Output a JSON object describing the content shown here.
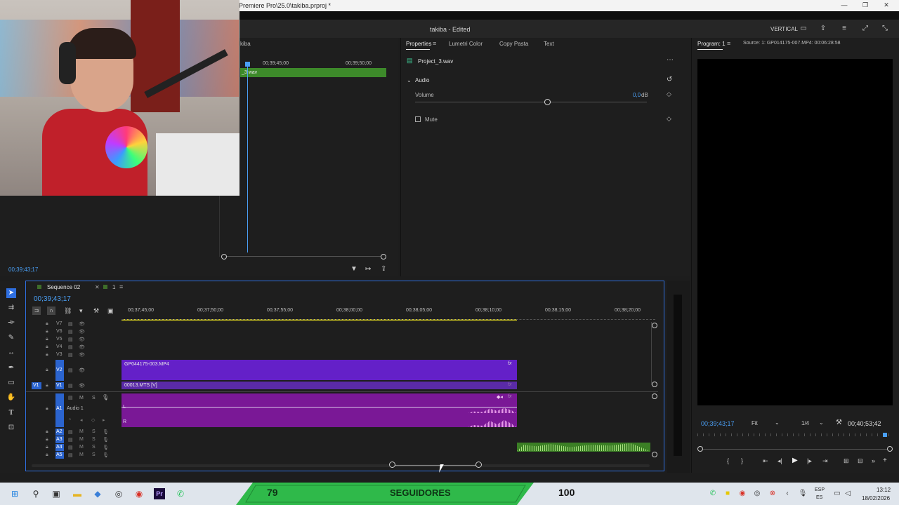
{
  "window": {
    "title": "Premiere Pro\\25.0\\takiba.prproj *",
    "minimize": "—",
    "restore": "❐",
    "close": "✕"
  },
  "header": {
    "project": "takiba - Edited",
    "workspace": "VERTICAL"
  },
  "source_monitor": {
    "tab_fragment": "kiba",
    "ruler": [
      "00;39;45;00",
      "00;39;50;00"
    ],
    "clip_name": "_3.wav",
    "timecode": "00;39;43;17"
  },
  "properties": {
    "tabs": [
      "Properties",
      "Lumetri Color",
      "Copy Pasta",
      "Text"
    ],
    "file_name": "Project_3.wav",
    "section": "Audio",
    "volume_label": "Volume",
    "volume_value": "0,0",
    "volume_unit": "dB",
    "volume_fraction": 0.57,
    "mute_label": "Mute"
  },
  "program": {
    "tab": "Program: 1",
    "source_info": "Source: 1: GP014175-007.MP4: 00:06:28:58",
    "timecode": "00;39;43;17",
    "fit": "Fit",
    "resolution": "1/4",
    "duration": "00;40;53;42"
  },
  "timeline": {
    "sequence_name": "Sequence 02",
    "sequence_tab2": "1",
    "timecode": "00;39;43;17",
    "ruler": [
      "00;37;45;00",
      "00;37;50;00",
      "00;37;55;00",
      "00;38;00;00",
      "00;38;05;00",
      "00;38;10;00",
      "00;38;15;00",
      "00;38;20;00"
    ],
    "video_tracks": [
      "V7",
      "V6",
      "V5",
      "V4",
      "V3",
      "V2",
      "V1"
    ],
    "audio_tracks": [
      "A1",
      "A2",
      "A3",
      "A4",
      "A5"
    ],
    "audio1_name": "Audio 1",
    "clip_v2": "GP044175-003.MP4",
    "clip_v1": "00013.MTS [V]",
    "fx": "fx",
    "ch_l": "L",
    "ch_r": "R",
    "src_v1": "V1",
    "m_label": "M",
    "s_label": "S"
  },
  "overlay": {
    "left_number": "79",
    "center_text": "SEGUIDORES",
    "right_number": "100",
    "color": "#2fb94a"
  },
  "taskbar": {
    "lang": "ESP",
    "lang2": "ES",
    "time": "13:12",
    "date": "18/02/2026"
  }
}
